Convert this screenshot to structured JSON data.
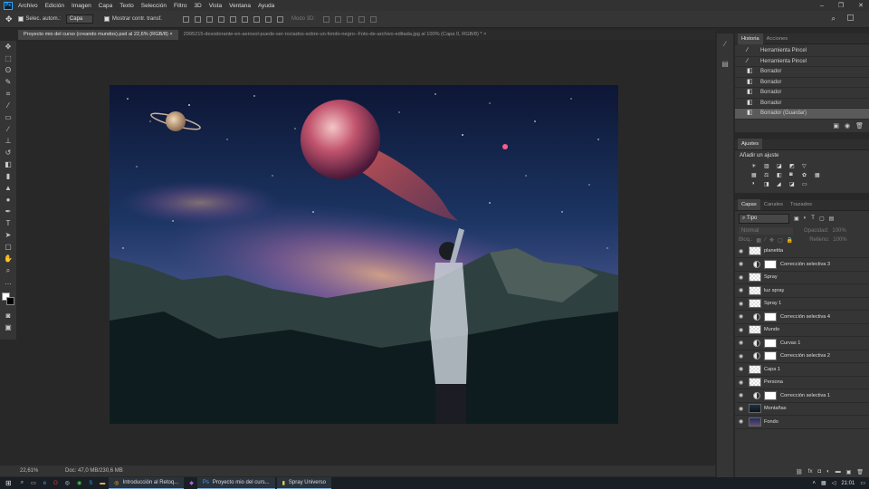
{
  "menu": [
    "Archivo",
    "Edición",
    "Imagen",
    "Capa",
    "Texto",
    "Selección",
    "Filtro",
    "3D",
    "Vista",
    "Ventana",
    "Ayuda"
  ],
  "app_icon": "Ps",
  "options": {
    "auto_select_label": "Selec. autom.:",
    "auto_select_value": "Capa",
    "transform_label": "Mostrar contr. transf.",
    "mode3d_label": "Modo 3D:"
  },
  "tabs": [
    "Proyecto mio del curso (creando mundos).psd al 22,6% (RGB/8)",
    "2995215-desodorante-en-aerosol-puede-ser-rociados-sobre-un-fondo-negro--Foto-de-archivo-editada.jpg al 100% (Capa 0, RGB/8) *"
  ],
  "status": {
    "zoom": "22,61%",
    "doc": "Doc: 47,0 MB/230,6 MB"
  },
  "history": {
    "tabs": [
      "Historia",
      "Acciones"
    ],
    "items": [
      "Herramienta Pincel",
      "Herramienta Pincel",
      "Borrador",
      "Borrador",
      "Borrador",
      "Borrador",
      "Borrador (Guardar)"
    ]
  },
  "adjustments": {
    "tab": "Ajustes",
    "subtitle": "Añadir un ajuste"
  },
  "layers": {
    "tabs": [
      "Capas",
      "Canales",
      "Trazados"
    ],
    "filter": "Tipo",
    "blend": "Normal",
    "opacity_label": "Opacidad:",
    "opacity": "100%",
    "lock_label": "Bloq.:",
    "fill_label": "Relleno:",
    "fill": "100%",
    "items": [
      {
        "name": "planetita",
        "kind": "layer"
      },
      {
        "name": "Corrección selectiva 3",
        "kind": "adj"
      },
      {
        "name": "Spray",
        "kind": "layer"
      },
      {
        "name": "luz spray",
        "kind": "layer"
      },
      {
        "name": "Spray 1",
        "kind": "layer"
      },
      {
        "name": "Corrección selectiva 4",
        "kind": "adj"
      },
      {
        "name": "Mundo",
        "kind": "layer"
      },
      {
        "name": "Curvas 1",
        "kind": "adj"
      },
      {
        "name": "Corrección selectiva 2",
        "kind": "adj"
      },
      {
        "name": "Capa 1",
        "kind": "layer"
      },
      {
        "name": "Persona",
        "kind": "layer"
      },
      {
        "name": "Corrección selectiva 1",
        "kind": "adj"
      },
      {
        "name": "Montañas",
        "kind": "layer"
      },
      {
        "name": "Fondo",
        "kind": "layer"
      }
    ]
  },
  "taskbar": {
    "tasks": [
      "Introducción al Retoq...",
      "Proyecto mio del curs...",
      "Spray Universo"
    ],
    "time": "21:01"
  }
}
